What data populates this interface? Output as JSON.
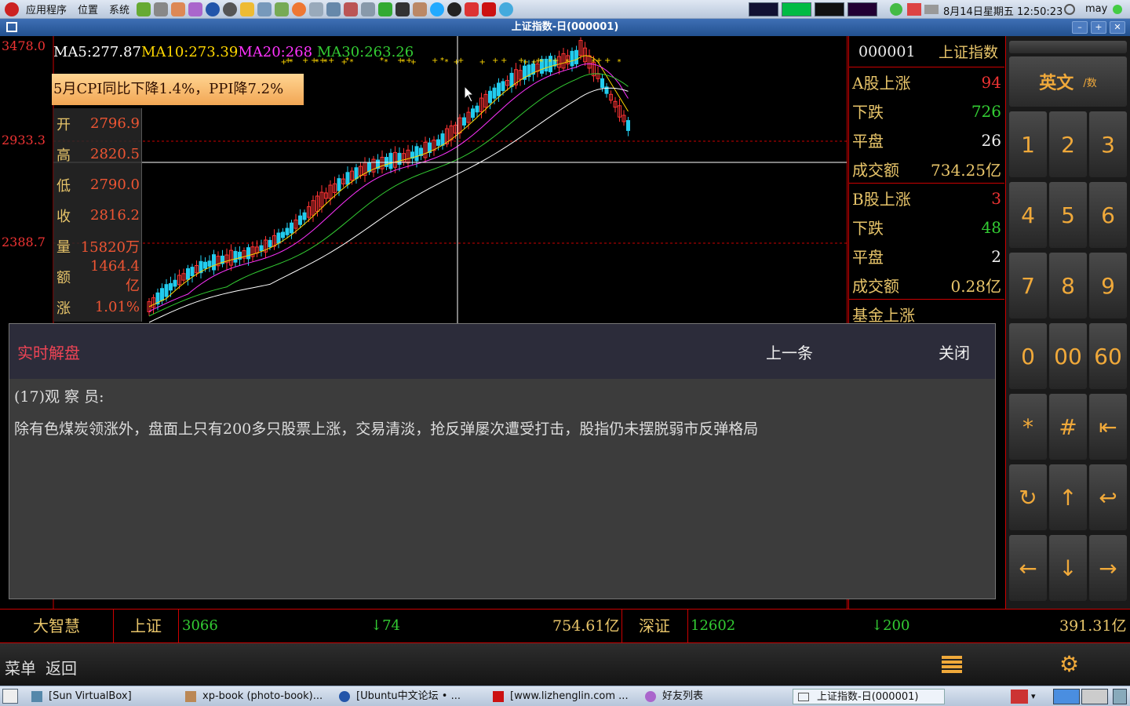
{
  "system_panel": {
    "menus": [
      "应用程序",
      "位置",
      "系统"
    ],
    "datetime": "8月14日星期五 12:50:23",
    "user": "may"
  },
  "window": {
    "title": "上证指数-日(000001)"
  },
  "chart": {
    "y_labels": [
      "3478.0",
      "2933.3",
      "2388.7"
    ],
    "ma_values": {
      "ma5": "MA5:277.87",
      "ma10": "MA10:273.39",
      "ma20": "MA20:268",
      "ma30": "MA30:263.26"
    },
    "news_banner": "5月CPI同比下降1.4%，PPI降7.2%",
    "ohlc": [
      {
        "label": "开",
        "value": "2796.9"
      },
      {
        "label": "高",
        "value": "2820.5"
      },
      {
        "label": "低",
        "value": "2790.0"
      },
      {
        "label": "收",
        "value": "2816.2"
      },
      {
        "label": "量",
        "value": "15820万"
      },
      {
        "label": "额",
        "value": "1464.4亿"
      },
      {
        "label": "涨",
        "value": "1.01%"
      }
    ],
    "colors": {
      "up": "#ff3333",
      "down": "#22ccee",
      "ma5": "#ffffff",
      "ma10": "#ffd700",
      "ma20": "#ff33ff",
      "ma30": "#33cc33"
    }
  },
  "right_panel": {
    "code": "000001",
    "name": "上证指数",
    "a_shares": {
      "up_label": "A股上涨",
      "up": "94",
      "down_label": "下跌",
      "down": "726",
      "flat_label": "平盘",
      "flat": "26",
      "turnover_label": "成交额",
      "turnover": "734.25亿"
    },
    "b_shares": {
      "up_label": "B股上涨",
      "up": "3",
      "down_label": "下跌",
      "down": "48",
      "flat_label": "平盘",
      "flat": "2",
      "turnover_label": "成交额",
      "turnover": "0.28亿"
    },
    "fund_partial": "基金上涨"
  },
  "keypad": {
    "mode_label": "英文",
    "mode_sub": "/数",
    "keys": [
      "1",
      "2",
      "3",
      "4",
      "5",
      "6",
      "7",
      "8",
      "9",
      "0",
      "00",
      "60",
      "*",
      "#",
      "⇤",
      "↻",
      "↑",
      "↩",
      "←",
      "↓",
      "→"
    ]
  },
  "dialog": {
    "title": "实时解盘",
    "prev": "上一条",
    "close": "关闭",
    "author": "(17)观 察 员:",
    "content": "除有色煤炭领涨外，盘面上只有200多只股票上涨，交易清淡，抢反弹屡次遭受打击，股指仍未摆脱弱市反弹格局"
  },
  "ticker": {
    "brand": "大智慧",
    "sh_label": "上证",
    "sh_index": "3066",
    "sh_change": "↓74",
    "sh_amount": "754.61亿",
    "sz_label": "深证",
    "sz_index": "12602",
    "sz_change": "↓200",
    "sz_amount": "391.31亿"
  },
  "appbar": {
    "menu": "菜单",
    "back": "返回"
  },
  "taskbar": {
    "tasks": [
      "[Sun VirtualBox]",
      "xp-book (photo-book)...",
      "[Ubuntu中文论坛 • ...",
      "[www.lizhenglin.com ...",
      "好友列表",
      "上证指数-日(000001)"
    ]
  }
}
